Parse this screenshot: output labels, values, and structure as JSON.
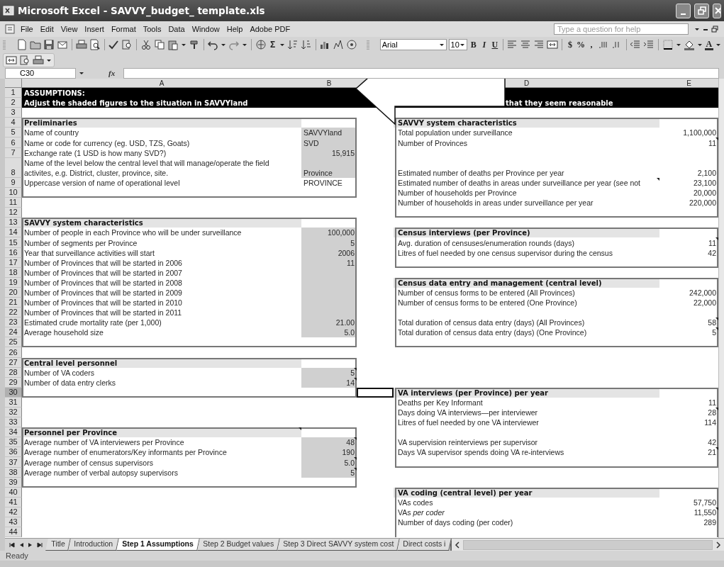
{
  "window": {
    "title": "Microsoft Excel - SAVVY_budget_ template.xls"
  },
  "menu": {
    "items": [
      "File",
      "Edit",
      "View",
      "Insert",
      "Format",
      "Tools",
      "Data",
      "Window",
      "Help",
      "Adobe PDF"
    ],
    "help_search": {
      "placeholder": "Type a question for help"
    }
  },
  "toolbar": {
    "sum": "Σ",
    "font": "Arial",
    "font_size": "10",
    "bold": "B",
    "italic": "I",
    "underline": "U",
    "currency": "$",
    "percent": "%",
    "comma": ",",
    "font_color": "A"
  },
  "formula_bar": {
    "name_box": "C30",
    "function_label": "fx"
  },
  "sheet": {
    "columns": [
      "A",
      "B",
      "D",
      "E"
    ],
    "rows": [
      {
        "number": "1",
        "a": {
          "kind": "banner",
          "text": "ASSUMPTIONS:"
        }
      },
      {
        "number": "2",
        "a": {
          "kind": "banner",
          "text": "Adjust the shaded figures to the situation in SAVVYland"
        },
        "d": {
          "kind": "banner",
          "text": "that they seem reasonable"
        }
      },
      {
        "number": "3"
      },
      {
        "number": "4",
        "a": {
          "kind": "heading",
          "text": "Preliminaries"
        },
        "d": {
          "kind": "heading",
          "text": "SAVVY system characteristics"
        }
      },
      {
        "number": "5",
        "a": {
          "kind": "label",
          "text": "Name of country"
        },
        "b": {
          "kind": "entry",
          "text": "SAVVYland",
          "shaded": true
        },
        "d": {
          "kind": "label",
          "text": "Total population under surveillance"
        },
        "e": {
          "kind": "value",
          "text": "1,100,000"
        }
      },
      {
        "number": "6",
        "a": {
          "kind": "label",
          "text": "Name or code for currency (eg. USD, TZS, Goats)"
        },
        "b": {
          "kind": "entry",
          "text": "SVD",
          "shaded": true
        },
        "d": {
          "kind": "label",
          "text": "Number of Provinces"
        },
        "e": {
          "kind": "value",
          "text": "11",
          "comment": true
        }
      },
      {
        "number": "7",
        "a": {
          "kind": "label",
          "text": "Exchange rate (1 USD is how many SVD?)"
        },
        "b": {
          "kind": "value",
          "text": "15,915",
          "shaded": true
        }
      },
      {
        "number": "8",
        "a": {
          "kind": "label",
          "text": "Name of the level below the central level that will manage/operate the field activites, e.g. District, cluster, province, site."
        },
        "b": {
          "kind": "entry",
          "text": "Province",
          "shaded": true
        },
        "d": {
          "kind": "label",
          "text": "Estimated number of deaths per Province per year"
        },
        "e": {
          "kind": "value",
          "text": "2,100"
        }
      },
      {
        "number": "9",
        "a": {
          "kind": "label",
          "text": "Uppercase version of name of operational level"
        },
        "b": {
          "kind": "entry",
          "text": "PROVINCE",
          "shaded": false
        },
        "d": {
          "kind": "label",
          "text": "Estimated number of deaths in areas under surveillance per year (see not",
          "comment": true
        },
        "e": {
          "kind": "value",
          "text": "23,100"
        }
      },
      {
        "number": "10",
        "d": {
          "kind": "label",
          "text": "Number of households per Province"
        },
        "e": {
          "kind": "value",
          "text": "20,000"
        }
      },
      {
        "number": "11",
        "d": {
          "kind": "label",
          "text": "Number of households in areas under surveillance per year"
        },
        "e": {
          "kind": "value",
          "text": "220,000"
        }
      },
      {
        "number": "12"
      },
      {
        "number": "13",
        "a": {
          "kind": "heading",
          "text": "SAVVY system characteristics"
        }
      },
      {
        "number": "14",
        "a": {
          "kind": "label",
          "text": "Number of people in each Province who will be under surveillance"
        },
        "b": {
          "kind": "value",
          "text": "100,000",
          "shaded": true
        },
        "d": {
          "kind": "heading",
          "text": "Census interviews (per Province)"
        }
      },
      {
        "number": "15",
        "a": {
          "kind": "label",
          "text": "Number of segments per Province"
        },
        "b": {
          "kind": "value",
          "text": "5",
          "shaded": true
        },
        "d": {
          "kind": "label",
          "text": "Avg. duration of censuses/enumeration rounds (days)"
        },
        "e": {
          "kind": "value",
          "text": "11",
          "comment": true
        }
      },
      {
        "number": "16",
        "a": {
          "kind": "label",
          "text": "Year that surveillance activities will start"
        },
        "b": {
          "kind": "value",
          "text": "2006",
          "shaded": true
        },
        "d": {
          "kind": "label",
          "text": "Litres of fuel needed by one census supervisor during the census"
        },
        "e": {
          "kind": "value",
          "text": "42"
        }
      },
      {
        "number": "17",
        "a": {
          "kind": "label",
          "text": "Number of Provinces that will be started in 2006"
        },
        "b": {
          "kind": "value",
          "text": "11",
          "shaded": true
        }
      },
      {
        "number": "18",
        "a": {
          "kind": "label",
          "text": "Number of Provinces that will be started in 2007"
        },
        "b": {
          "kind": "value",
          "shaded": true
        }
      },
      {
        "number": "19",
        "a": {
          "kind": "label",
          "text": "Number of Provinces that will be started in 2008"
        },
        "b": {
          "kind": "value",
          "shaded": true
        },
        "d": {
          "kind": "heading",
          "text": "Census data entry and management (central level)"
        }
      },
      {
        "number": "20",
        "a": {
          "kind": "label",
          "text": "Number of Provinces that will be started in 2009"
        },
        "b": {
          "kind": "value",
          "shaded": true
        },
        "d": {
          "kind": "label",
          "text": "Number of census forms to be entered (All Provinces)"
        },
        "e": {
          "kind": "value",
          "text": "242,000"
        }
      },
      {
        "number": "21",
        "a": {
          "kind": "label",
          "text": "Number of Provinces that will be started in 2010"
        },
        "b": {
          "kind": "value",
          "shaded": true
        },
        "d": {
          "kind": "label",
          "text": "Number of census forms to be entered (One Province)"
        },
        "e": {
          "kind": "value",
          "text": "22,000"
        }
      },
      {
        "number": "22",
        "a": {
          "kind": "label",
          "text": "Number of Provinces that will be started in 2011"
        },
        "b": {
          "kind": "value",
          "shaded": true
        }
      },
      {
        "number": "23",
        "a": {
          "kind": "label",
          "text": "Estimated crude mortality rate (per 1,000)"
        },
        "b": {
          "kind": "value",
          "text": "21.00",
          "shaded": true
        },
        "d": {
          "kind": "label",
          "text": "Total duration of census data entry (days) (All Provinces)"
        },
        "e": {
          "kind": "value",
          "text": "58",
          "comment": true
        }
      },
      {
        "number": "24",
        "a": {
          "kind": "label",
          "text": "Average household size"
        },
        "b": {
          "kind": "value",
          "text": "5.0",
          "shaded": true
        },
        "d": {
          "kind": "label",
          "text": "Total duration of census data entry (days) (One Province)"
        },
        "e": {
          "kind": "value",
          "text": "5",
          "comment": true
        }
      },
      {
        "number": "25"
      },
      {
        "number": "26"
      },
      {
        "number": "27",
        "a": {
          "kind": "heading",
          "text": "Central level personnel"
        }
      },
      {
        "number": "28",
        "a": {
          "kind": "label",
          "text": "Number of VA coders"
        },
        "b": {
          "kind": "value",
          "text": "5",
          "shaded": true,
          "comment": true
        }
      },
      {
        "number": "29",
        "a": {
          "kind": "label",
          "text": "Number of data entry clerks"
        },
        "b": {
          "kind": "value",
          "text": "14",
          "shaded": true,
          "comment": true
        }
      },
      {
        "number": "30",
        "selected_cell": true,
        "d": {
          "kind": "heading",
          "text": "VA interviews (per Province) per year"
        }
      },
      {
        "number": "31",
        "d": {
          "kind": "label",
          "text": "Deaths per Key Informant"
        },
        "e": {
          "kind": "value",
          "text": "11"
        }
      },
      {
        "number": "32",
        "d": {
          "kind": "label",
          "text": "Days doing VA interviews—per interviewer"
        },
        "e": {
          "kind": "value",
          "text": "28",
          "comment": true
        }
      },
      {
        "number": "33",
        "d": {
          "kind": "label",
          "text": "Litres of fuel needed by one VA interviewer"
        },
        "e": {
          "kind": "value",
          "text": "114"
        }
      },
      {
        "number": "34",
        "a": {
          "kind": "heading",
          "text": "Personnel per Province",
          "comment": true
        }
      },
      {
        "number": "35",
        "a": {
          "kind": "label",
          "text": "Average number of VA interviewers per Province"
        },
        "b": {
          "kind": "value",
          "text": "48",
          "shaded": true,
          "comment": true
        },
        "d": {
          "kind": "label",
          "text": "VA supervision reinterviews per supervisor"
        },
        "e": {
          "kind": "value",
          "text": "42"
        }
      },
      {
        "number": "36",
        "a": {
          "kind": "label",
          "text": "Average number of enumerators/Key informants per Province"
        },
        "b": {
          "kind": "value",
          "text": "190",
          "shaded": true
        },
        "d": {
          "kind": "label",
          "text": "Days VA supervisor spends doing VA re-interviews"
        },
        "e": {
          "kind": "value",
          "text": "21",
          "comment": true
        }
      },
      {
        "number": "37",
        "a": {
          "kind": "label",
          "text": "Average number of census supervisors"
        },
        "b": {
          "kind": "value",
          "text": "5.0",
          "shaded": true,
          "comment": true
        }
      },
      {
        "number": "38",
        "a": {
          "kind": "label",
          "text": "Average number of verbal autopsy supervisors"
        },
        "b": {
          "kind": "value",
          "text": "5",
          "shaded": true,
          "comment": true
        }
      },
      {
        "number": "39"
      },
      {
        "number": "40",
        "d": {
          "kind": "heading",
          "text": "VA coding (central level) per year"
        }
      },
      {
        "number": "41",
        "d": {
          "kind": "label",
          "text": "VAs codes"
        },
        "e": {
          "kind": "value",
          "text": "57,750"
        }
      },
      {
        "number": "42",
        "d": {
          "kind": "label",
          "text": "VAs *per coder*"
        },
        "e": {
          "kind": "value",
          "text": "11,550",
          "comment": true
        }
      },
      {
        "number": "43",
        "d": {
          "kind": "label",
          "text": "Number of days coding (per coder)"
        },
        "e": {
          "kind": "value",
          "text": "289"
        }
      },
      {
        "number": "44"
      }
    ]
  },
  "sheet_tabs": [
    {
      "label": "Title",
      "selected": false
    },
    {
      "label": "Introduction",
      "selected": false
    },
    {
      "label": "Step 1 Assumptions",
      "selected": true
    },
    {
      "label": "Step 2 Budget values",
      "selected": false
    },
    {
      "label": "Step 3 Direct SAVVY system cost",
      "selected": false
    },
    {
      "label": "Direct costs i",
      "selected": false
    }
  ],
  "status_bar": {
    "text": "Ready"
  }
}
